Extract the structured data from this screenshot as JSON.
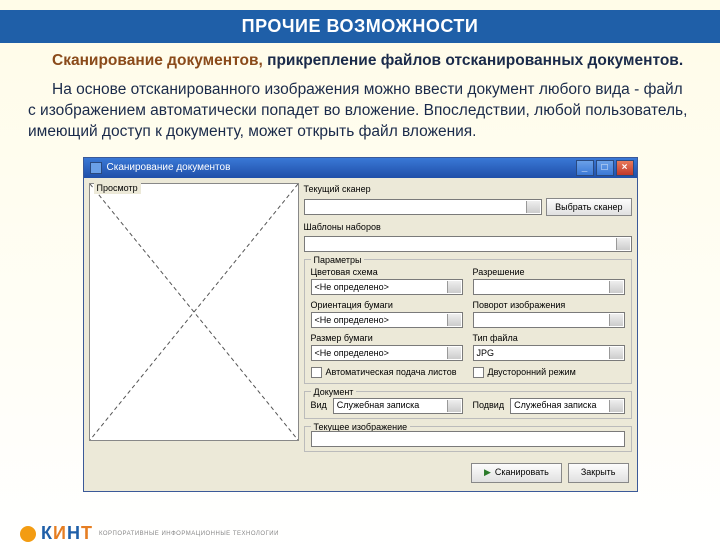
{
  "banner": "ПРОЧИЕ ВОЗМОЖНОСТИ",
  "intro": {
    "lead_bold": "Сканирование документов, ",
    "lead_rest": "прикрепление файлов отсканированных документов.",
    "body": "На основе отсканированного изображения можно ввести документ любого вида - файл с изображением автоматически попадет во вложение. Впоследствии, любой пользователь, имеющий доступ к документу, может открыть файл вложения."
  },
  "window": {
    "title": "Сканирование документов",
    "preview_label": "Просмотр",
    "scanner": {
      "label": "Текущий сканер",
      "value": "",
      "select_btn": "Выбрать сканер"
    },
    "templates": {
      "label": "Шаблоны наборов",
      "value": ""
    },
    "params": {
      "legend": "Параметры",
      "color": {
        "label": "Цветовая схема",
        "value": "<Не определено>"
      },
      "resolution": {
        "label": "Разрешение",
        "value": ""
      },
      "orientation": {
        "label": "Ориентация бумаги",
        "value": "<Не определено>"
      },
      "rotate": {
        "label": "Поворот изображения",
        "value": ""
      },
      "paper": {
        "label": "Размер бумаги",
        "value": "<Не определено>"
      },
      "format": {
        "label": "Тип файла",
        "value": "JPG"
      },
      "autofeed": "Автоматическая подача листов",
      "duplex": "Двусторонний режим"
    },
    "document": {
      "legend": "Документ",
      "type": {
        "label": "Вид",
        "value": "Служебная записка"
      },
      "subtype": {
        "label": "Подвид",
        "value": "Служебная записка"
      }
    },
    "current_image": {
      "legend": "Текущее изображение",
      "value": ""
    },
    "buttons": {
      "scan": "Сканировать",
      "close": "Закрыть"
    }
  },
  "logo": {
    "letters": [
      "К",
      "И",
      "Н",
      "Т"
    ],
    "tagline": "КОРПОРАТИВНЫЕ ИНФОРМАЦИОННЫЕ ТЕХНОЛОГИИ"
  }
}
